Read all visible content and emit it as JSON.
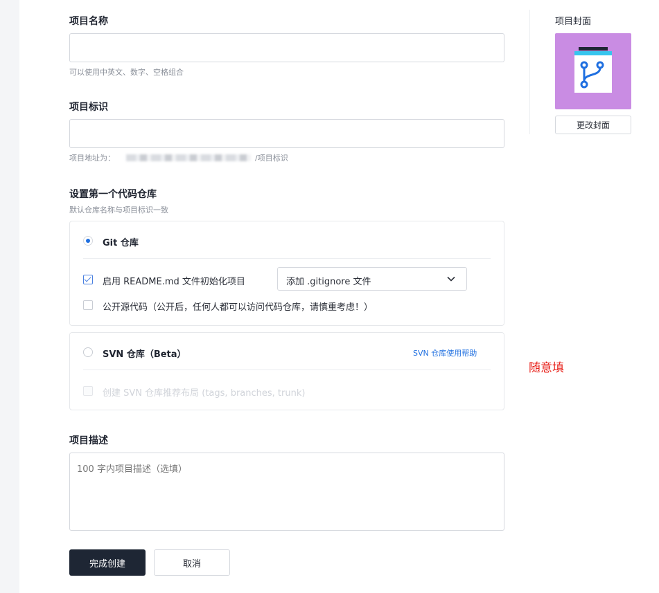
{
  "form": {
    "name_label": "项目名称",
    "name_value": "",
    "name_hint": "可以使用中英文、数字、空格组合",
    "id_label": "项目标识",
    "id_value": "",
    "id_hint_prefix": "项目地址为：",
    "id_hint_suffix": "/项目标识",
    "repo_title": "设置第一个代码仓库",
    "repo_hint": "默认仓库名称与项目标识一致",
    "git": {
      "label": "Git 仓库",
      "selected": true,
      "readme_label": "启用 README.md 文件初始化项目",
      "readme_checked": true,
      "gitignore_select": "添加 .gitignore 文件",
      "public_label": "公开源代码（公开后，任何人都可以访问代码仓库，请慎重考虑！）",
      "public_checked": false
    },
    "svn": {
      "label": "SVN 仓库（Beta）",
      "help_link": "SVN 仓库使用帮助",
      "layout_label": "创建 SVN 仓库推荐布局 (tags, branches, trunk)"
    },
    "desc_label": "项目描述",
    "desc_placeholder": "100 字内项目描述（选填）"
  },
  "cover": {
    "title": "项目封面",
    "change_button": "更改封面",
    "icon": "git-branch-icon",
    "bg_color": "#c98ce3"
  },
  "annotation": "随意填",
  "actions": {
    "create_button": "完成创建",
    "cancel_button": "取消"
  },
  "colors": {
    "primary": "#1f6fe0",
    "dark_button": "#1e2634",
    "annotation": "#e8221b",
    "link": "#1f6fe0"
  }
}
